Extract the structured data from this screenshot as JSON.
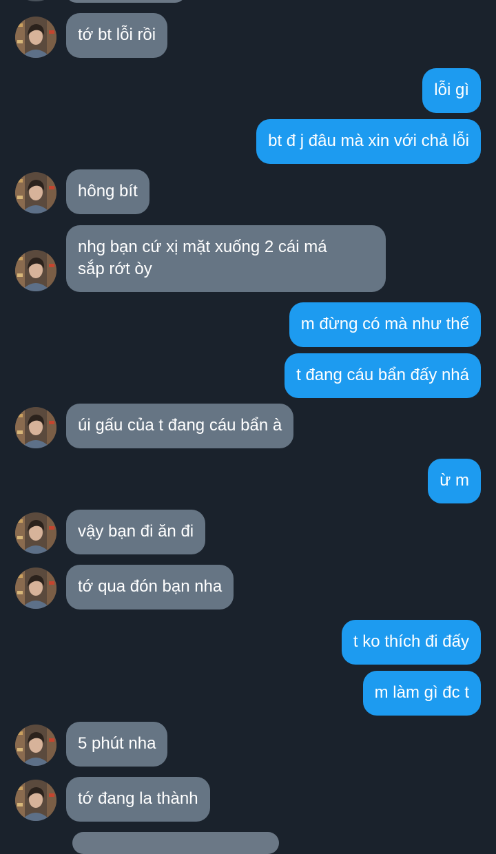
{
  "chat": {
    "messages": [
      {
        "direction": "incoming",
        "text": "tớ bt lỗi rồi",
        "avatar": true
      },
      {
        "direction": "outgoing",
        "text": "lỗi gì"
      },
      {
        "direction": "outgoing",
        "text": "bt đ j đâu mà xin với chả lỗi"
      },
      {
        "direction": "incoming",
        "text": "hông bít",
        "avatar": true
      },
      {
        "direction": "incoming",
        "lines": [
          "nhg bạn cứ xị mặt xuống 2 cái má",
          "sắp rớt òy"
        ],
        "avatar": true
      },
      {
        "direction": "outgoing",
        "text": "m đừng có mà như thế"
      },
      {
        "direction": "outgoing",
        "text": "t đang cáu bẩn đấy nhá"
      },
      {
        "direction": "incoming",
        "text": "úi gấu của t đang cáu bẩn à",
        "avatar": true
      },
      {
        "direction": "outgoing",
        "text": "ừ m"
      },
      {
        "direction": "incoming",
        "text": "vậy bạn đi ăn đi",
        "avatar": true
      },
      {
        "direction": "incoming",
        "text": "tớ qua đón bạn nha",
        "avatar": true
      },
      {
        "direction": "outgoing",
        "text": "t ko thích đi đấy"
      },
      {
        "direction": "outgoing",
        "text": "m làm gì đc t"
      },
      {
        "direction": "incoming",
        "text": "5 phút nha",
        "avatar": true
      },
      {
        "direction": "incoming",
        "text": "tớ đang la thành",
        "avatar": true
      }
    ]
  },
  "colors": {
    "background": "#1a222c",
    "incoming_bubble": "#667584",
    "outgoing_bubble": "#1d9bf0",
    "text": "#ffffff"
  },
  "icons": {
    "avatar": "contact-avatar-photo"
  }
}
